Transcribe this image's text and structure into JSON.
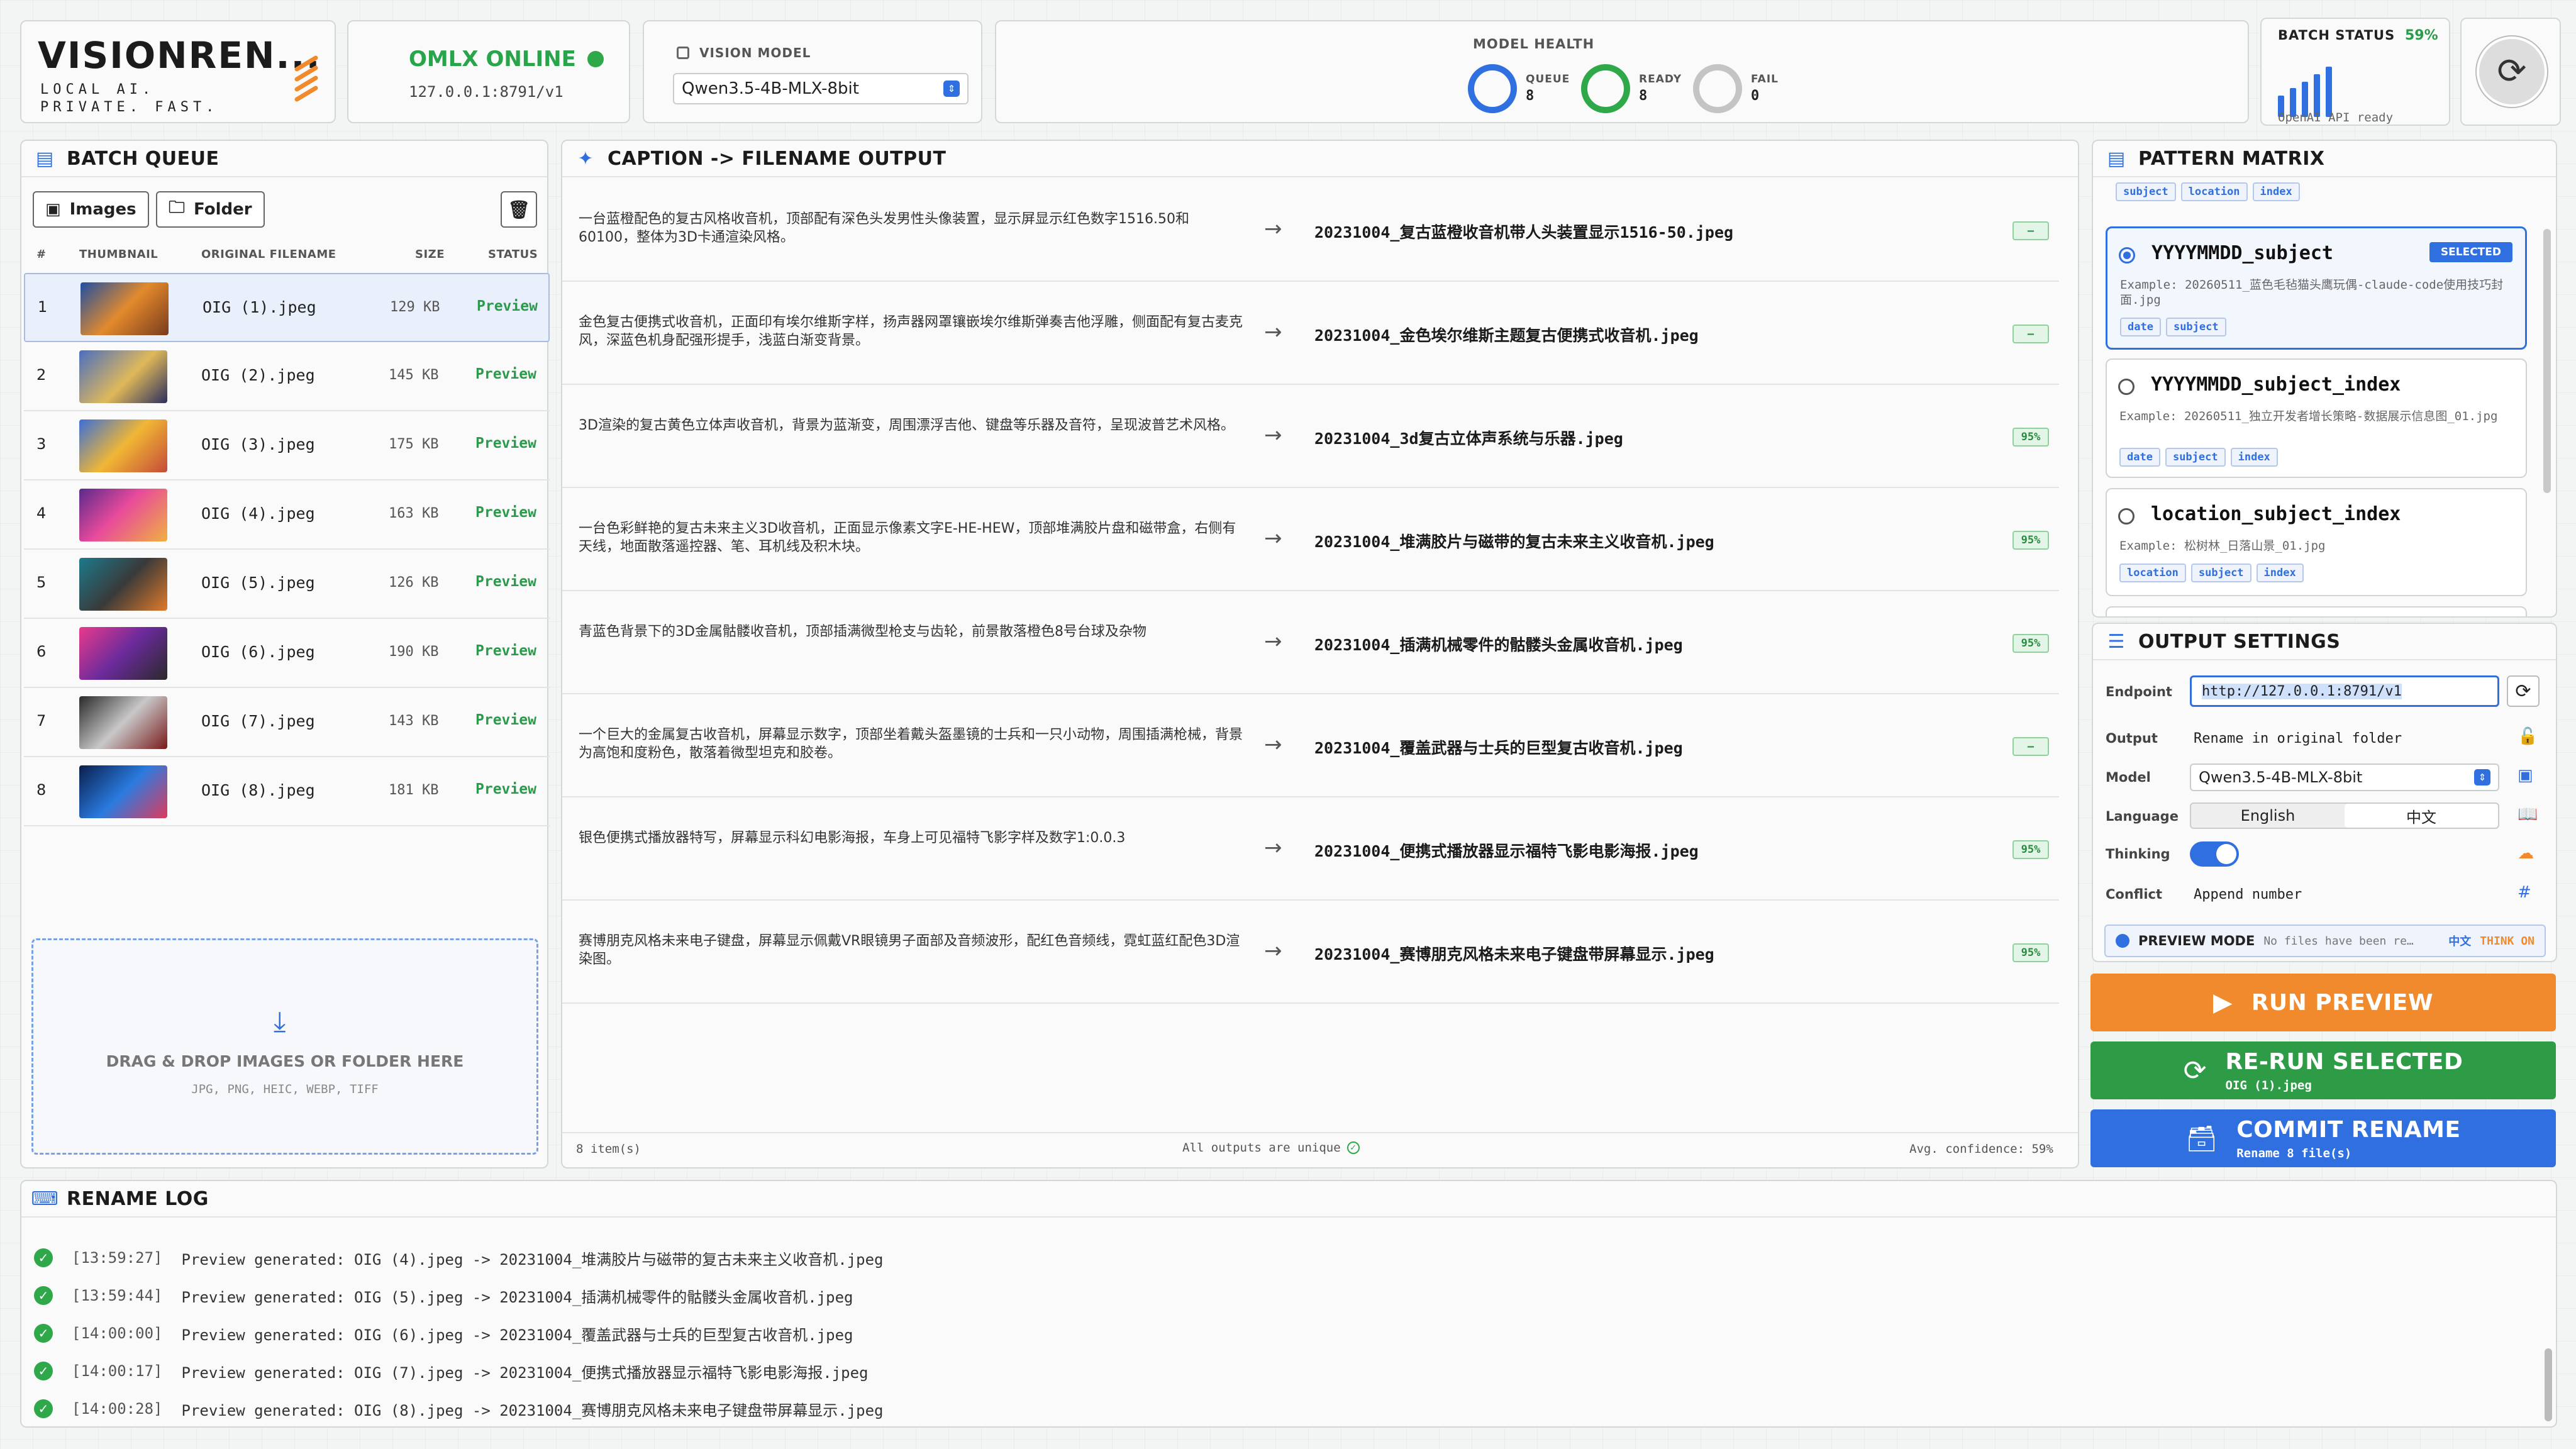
{
  "brand": {
    "title": "VISIONREN...",
    "subtitle_line1": "LOCAL AI.",
    "subtitle_line2": "PRIVATE. FAST."
  },
  "server": {
    "status": "OMLX ONLINE",
    "endpoint": "127.0.0.1:8791/v1"
  },
  "vision_model": {
    "label": "VISION MODEL",
    "selected": "Qwen3.5-4B-MLX-8bit"
  },
  "model_health": {
    "title": "MODEL HEALTH",
    "queue_label": "QUEUE",
    "queue_value": "8",
    "ready_label": "READY",
    "ready_value": "8",
    "fail_label": "FAIL",
    "fail_value": "0",
    "colors": {
      "queue": "#2f6fe0",
      "ready": "#2fa84a",
      "fail": "#c4c4c4"
    }
  },
  "batch_status": {
    "title": "BATCH STATUS",
    "percent": "59%",
    "caption": "OpenAI API ready"
  },
  "batch_queue": {
    "title": "BATCH QUEUE",
    "images_button": "Images",
    "folder_button": "Folder",
    "columns": [
      "#",
      "THUMBNAIL",
      "ORIGINAL FILENAME",
      "SIZE",
      "STATUS"
    ],
    "rows": [
      {
        "n": "1",
        "filename": "OIG (1).jpeg",
        "size": "129 KB",
        "status": "Preview"
      },
      {
        "n": "2",
        "filename": "OIG (2).jpeg",
        "size": "145 KB",
        "status": "Preview"
      },
      {
        "n": "3",
        "filename": "OIG (3).jpeg",
        "size": "175 KB",
        "status": "Preview"
      },
      {
        "n": "4",
        "filename": "OIG (4).jpeg",
        "size": "163 KB",
        "status": "Preview"
      },
      {
        "n": "5",
        "filename": "OIG (5).jpeg",
        "size": "126 KB",
        "status": "Preview"
      },
      {
        "n": "6",
        "filename": "OIG (6).jpeg",
        "size": "190 KB",
        "status": "Preview"
      },
      {
        "n": "7",
        "filename": "OIG (7).jpeg",
        "size": "143 KB",
        "status": "Preview"
      },
      {
        "n": "8",
        "filename": "OIG (8).jpeg",
        "size": "181 KB",
        "status": "Preview"
      }
    ],
    "drop_title": "DRAG & DROP IMAGES OR FOLDER HERE",
    "drop_formats": "JPG, PNG, HEIC, WEBP, TIFF"
  },
  "caption_output": {
    "title": "CAPTION -> FILENAME OUTPUT",
    "rows": [
      {
        "caption": "一台蓝橙配色的复古风格收音机，顶部配有深色头发男性头像装置，显示屏显示红色数字1516.50和60100，整体为3D卡通渲染风格。",
        "output": "20231004_复古蓝橙收音机带人头装置显示1516-50.jpeg",
        "confidence": "—"
      },
      {
        "caption": "金色复古便携式收音机，正面印有埃尔维斯字样，扬声器网罩镶嵌埃尔维斯弹奏吉他浮雕，侧面配有复古麦克风，深蓝色机身配强形提手，浅蓝白渐变背景。",
        "output": "20231004_金色埃尔维斯主题复古便携式收音机.jpeg",
        "confidence": "—"
      },
      {
        "caption": "3D渲染的复古黄色立体声收音机，背景为蓝渐变，周围漂浮吉他、键盘等乐器及音符，呈现波普艺术风格。",
        "output": "20231004_3d复古立体声系统与乐器.jpeg",
        "confidence": "95%"
      },
      {
        "caption": "一台色彩鲜艳的复古未来主义3D收音机，正面显示像素文字E-HE-HEW，顶部堆满胶片盘和磁带盒，右侧有天线，地面散落遥控器、笔、耳机线及积木块。",
        "output": "20231004_堆满胶片与磁带的复古未来主义收音机.jpeg",
        "confidence": "95%"
      },
      {
        "caption": "青蓝色背景下的3D金属骷髅收音机，顶部插满微型枪支与齿轮，前景散落橙色8号台球及杂物",
        "output": "20231004_插满机械零件的骷髅头金属收音机.jpeg",
        "confidence": "95%"
      },
      {
        "caption": "一个巨大的金属复古收音机，屏幕显示数字，顶部坐着戴头盔墨镜的士兵和一只小动物，周围插满枪械，背景为高饱和度粉色，散落着微型坦克和胶卷。",
        "output": "20231004_覆盖武器与士兵的巨型复古收音机.jpeg",
        "confidence": "—"
      },
      {
        "caption": "银色便携式播放器特写，屏幕显示科幻电影海报，车身上可见福特飞影字样及数字1:0.0.3",
        "output": "20231004_便携式播放器显示福特飞影电影海报.jpeg",
        "confidence": "95%"
      },
      {
        "caption": "赛博朋克风格未来电子键盘，屏幕显示佩戴VR眼镜男子面部及音频波形，配红色音频线，霓虹蓝红配色3D渲染图。",
        "output": "20231004_赛博朋克风格未来电子键盘带屏幕显示.jpeg",
        "confidence": "95%"
      }
    ],
    "footer_count": "8 item(s)",
    "footer_unique": "All outputs are unique",
    "footer_conf": "Avg. confidence: 59%"
  },
  "pattern_matrix": {
    "title": "PATTERN MATRIX",
    "top_tags": [
      "subject",
      "location",
      "index"
    ],
    "patterns": [
      {
        "name": "YYYYMMDD_subject",
        "badge": "SELECTED",
        "example": "Example: 20260511_蓝色毛毡猫头鹰玩偶-claude-code使用技巧封面.jpg",
        "tags": [
          "date",
          "subject"
        ]
      },
      {
        "name": "YYYYMMDD_subject_index",
        "example": "Example: 20260511_独立开发者增长策略-数据展示信息图_01.jpg",
        "tags": [
          "date",
          "subject",
          "index"
        ]
      },
      {
        "name": "location_subject_index",
        "example": "Example: 松树林_日落山景_01.jpg",
        "tags": [
          "location",
          "subject",
          "index"
        ]
      }
    ]
  },
  "output_settings": {
    "title": "OUTPUT SETTINGS",
    "endpoint_label": "Endpoint",
    "endpoint_value": "http://127.0.0.1:8791/v1",
    "output_label": "Output",
    "output_value": "Rename in original folder",
    "model_label": "Model",
    "model_value": "Qwen3.5-4B-MLX-8bit",
    "language_label": "Language",
    "language_en": "English",
    "language_zh": "中文",
    "thinking_label": "Thinking",
    "thinking_on": true,
    "conflict_label": "Conflict",
    "conflict_value": "Append number",
    "preview_mode_label": "PREVIEW MODE",
    "preview_mode_text": "No files have been re…",
    "preview_lang": "中文",
    "preview_think": "THINK ON"
  },
  "actions": {
    "run_preview": "RUN PREVIEW",
    "rerun_selected": "RE-RUN SELECTED",
    "rerun_sub": "OIG (1).jpeg",
    "commit_rename": "COMMIT RENAME",
    "commit_sub": "Rename 8 file(s)",
    "colors": {
      "run": "#f08a2c",
      "rerun": "#2e9b47",
      "commit": "#2f6fe0"
    }
  },
  "rename_log": {
    "title": "RENAME LOG",
    "entries": [
      {
        "time": "[13:59:27]",
        "text": "Preview generated: OIG (4).jpeg -> 20231004_堆满胶片与磁带的复古未来主义收音机.jpeg"
      },
      {
        "time": "[13:59:44]",
        "text": "Preview generated: OIG (5).jpeg -> 20231004_插满机械零件的骷髅头金属收音机.jpeg"
      },
      {
        "time": "[14:00:00]",
        "text": "Preview generated: OIG (6).jpeg -> 20231004_覆盖武器与士兵的巨型复古收音机.jpeg"
      },
      {
        "time": "[14:00:17]",
        "text": "Preview generated: OIG (7).jpeg -> 20231004_便携式播放器显示福特飞影电影海报.jpeg"
      },
      {
        "time": "[14:00:28]",
        "text": "Preview generated: OIG (8).jpeg -> 20231004_赛博朋克风格未来电子键盘带屏幕显示.jpeg"
      }
    ]
  }
}
